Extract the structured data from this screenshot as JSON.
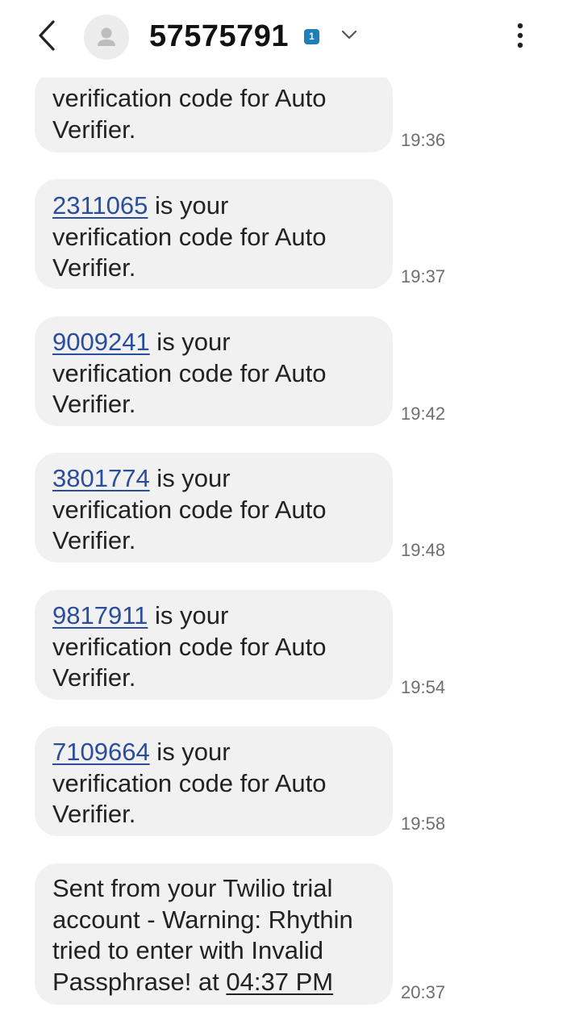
{
  "header": {
    "contact": "57575791",
    "sim_badge": "1"
  },
  "messages": [
    {
      "partial": true,
      "lines": [
        "verification code for Auto",
        "Verifier."
      ],
      "time": "19:36"
    },
    {
      "code": "2311065",
      "first_rest": " is your",
      "lines": [
        "verification code for Auto",
        "Verifier."
      ],
      "time": "19:37"
    },
    {
      "code": "9009241",
      "first_rest": " is your",
      "lines": [
        "verification code for Auto",
        "Verifier."
      ],
      "time": "19:42"
    },
    {
      "code": "3801774",
      "first_rest": " is your",
      "lines": [
        "verification code for Auto",
        "Verifier."
      ],
      "time": "19:48"
    },
    {
      "code": "9817911",
      "first_rest": " is your",
      "lines": [
        "verification code for Auto",
        "Verifier."
      ],
      "time": "19:54"
    },
    {
      "code": "7109664",
      "first_rest": " is your",
      "lines": [
        "verification code for Auto",
        "Verifier."
      ],
      "time": "19:58"
    },
    {
      "lines": [
        "Sent from your Twilio trial",
        "account - Warning: Rhythin",
        "tried to enter with Invalid"
      ],
      "last_prefix": "Passphrase! at ",
      "last_link": "04:37 PM",
      "time": "20:37"
    }
  ],
  "colors": {
    "bubble": "#f1f1f1",
    "code_link": "#2a4d9c",
    "timestamp": "#6e6e6e",
    "sim_badge": "#1e7fb8"
  },
  "icons": {
    "back": "chevron-left-icon",
    "avatar": "person-icon",
    "sim": "sim-1-icon",
    "expand": "chevron-down-icon",
    "menu": "more-vertical-icon"
  }
}
